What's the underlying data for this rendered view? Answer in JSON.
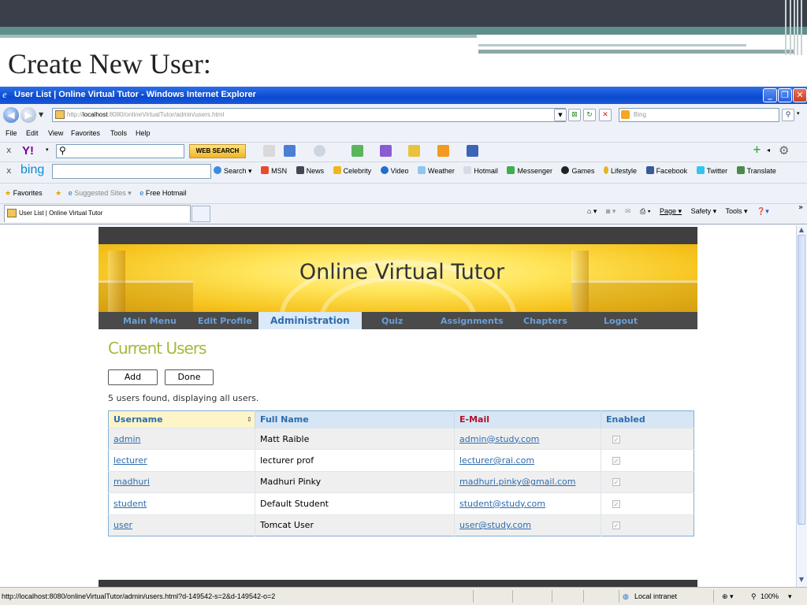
{
  "slide": {
    "title": "Create New User:"
  },
  "window": {
    "title": "User List | Online Virtual Tutor - Windows Internet Explorer"
  },
  "address_bar": {
    "prefix": "http://",
    "host": "localhost",
    "rest": ":8080/onlineVirtualTutor/admin/users.html"
  },
  "search_box": {
    "placeholder": "Bing"
  },
  "menu": {
    "file": "File",
    "edit": "Edit",
    "view": "View",
    "favorites": "Favorites",
    "tools": "Tools",
    "help": "Help"
  },
  "yahoo_toolbar": {
    "logo": "Y!",
    "web_search": "WEB SEARCH"
  },
  "bing_toolbar": {
    "logo": "bing",
    "links": [
      "Search",
      "MSN",
      "News",
      "Celebrity",
      "Video",
      "Weather",
      "Hotmail",
      "Messenger",
      "Games",
      "Lifestyle",
      "Facebook",
      "Twitter",
      "Translate"
    ]
  },
  "favorites_bar": {
    "favorites": "Favorites",
    "suggested": "Suggested Sites ▾",
    "hotmail": "Free Hotmail"
  },
  "tab": {
    "title": "User List | Online Virtual Tutor"
  },
  "command_bar": {
    "page": "Page ▾",
    "safety": "Safety ▾",
    "tools": "Tools ▾"
  },
  "site": {
    "name": "Online Virtual Tutor",
    "nav": {
      "main_menu": "Main Menu",
      "edit_profile": "Edit Profile",
      "administration": "Administration",
      "quiz": "Quiz",
      "assignments": "Assignments",
      "chapters": "Chapters",
      "logout": "Logout"
    }
  },
  "page": {
    "heading": "Current Users",
    "add_label": "Add",
    "done_label": "Done",
    "count_text": "5 users found, displaying all users."
  },
  "table": {
    "headers": {
      "username": "Username",
      "full_name": "Full Name",
      "email": "E-Mail",
      "enabled": "Enabled"
    },
    "rows": [
      {
        "username": "admin",
        "full_name": "Matt Raible",
        "email": "admin@study.com",
        "enabled": "✓"
      },
      {
        "username": "lecturer",
        "full_name": "lecturer prof",
        "email": "lecturer@rai.com",
        "enabled": "✓"
      },
      {
        "username": "madhuri",
        "full_name": "Madhuri Pinky",
        "email": "madhuri.pinky@gmail.com",
        "enabled": "✓"
      },
      {
        "username": "student",
        "full_name": "Default Student",
        "email": "student@study.com",
        "enabled": "✓"
      },
      {
        "username": "user",
        "full_name": "Tomcat User",
        "email": "user@study.com",
        "enabled": "✓"
      }
    ]
  },
  "status_bar": {
    "url": "http://localhost:8080/onlineVirtualTutor/admin/users.html?d-149542-s=2&d-149542-o=2",
    "zone": "Local intranet",
    "zoom": "100%"
  },
  "colors": {
    "ie_title": "#0a4ad0",
    "heading": "#a8b83c",
    "link": "#2d6cae",
    "email_header": "#b0122b"
  }
}
